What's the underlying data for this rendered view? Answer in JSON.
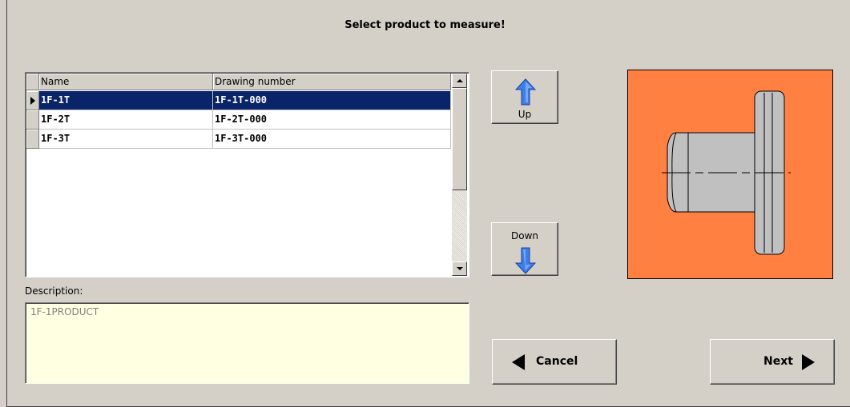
{
  "title": "Select product to measure!",
  "table": {
    "columns": [
      "Name",
      "Drawing number"
    ],
    "rows": [
      {
        "name": "1F-1T",
        "drawing": "1F-1T-000",
        "selected": true
      },
      {
        "name": "1F-2T",
        "drawing": "1F-2T-000",
        "selected": false
      },
      {
        "name": "1F-3T",
        "drawing": "1F-3T-000",
        "selected": false
      }
    ]
  },
  "description": {
    "label": "Description:",
    "value": "1F-1PRODUCT"
  },
  "buttons": {
    "up": "Up",
    "down": "Down",
    "cancel": "Cancel",
    "next": "Next"
  },
  "colors": {
    "selection": "#0a246a",
    "image_background": "#ff8040",
    "description_background": "#ffffe1"
  },
  "product_image": {
    "icon": "flanged-shaft-drawing-icon"
  }
}
